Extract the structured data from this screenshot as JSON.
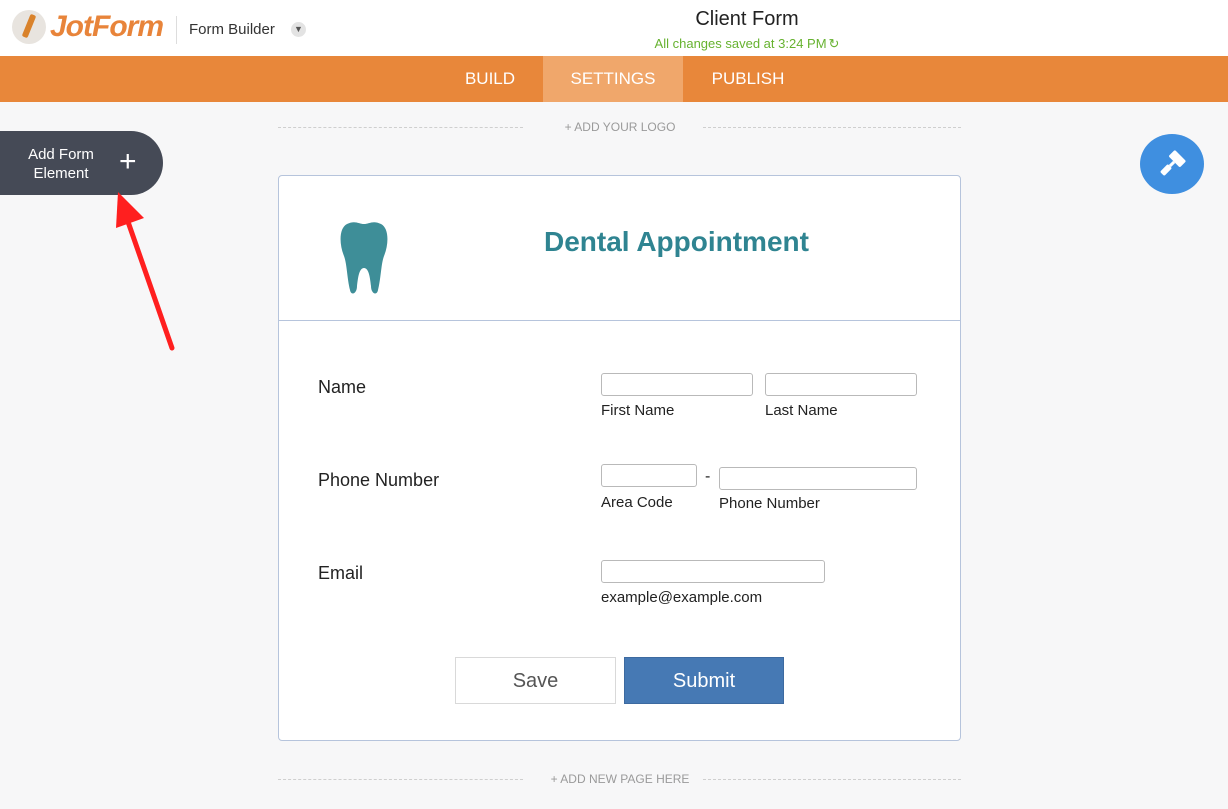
{
  "header": {
    "logo_text": "JotForm",
    "builder_label": "Form Builder",
    "form_title": "Client Form",
    "save_status": "All changes saved at 3:24 PM"
  },
  "nav": {
    "tabs": [
      {
        "label": "BUILD",
        "active": false
      },
      {
        "label": "SETTINGS",
        "active": true
      },
      {
        "label": "PUBLISH",
        "active": false
      }
    ]
  },
  "sidebar": {
    "add_element_label": "Add Form Element"
  },
  "canvas": {
    "add_logo_label": "+ ADD YOUR LOGO",
    "add_page_label": "+ ADD NEW PAGE HERE"
  },
  "form": {
    "heading": "Dental Appointment",
    "fields": {
      "name": {
        "label": "Name",
        "first_sublabel": "First Name",
        "last_sublabel": "Last Name"
      },
      "phone": {
        "label": "Phone Number",
        "area_sublabel": "Area Code",
        "separator": "-",
        "number_sublabel": "Phone Number"
      },
      "email": {
        "label": "Email",
        "sublabel": "example@example.com"
      }
    },
    "buttons": {
      "save": "Save",
      "submit": "Submit"
    }
  },
  "colors": {
    "brand_orange": "#e8873a",
    "active_tab": "#f0a76b",
    "heading_teal": "#2f8491",
    "submit_blue": "#4679b4",
    "status_green": "#66b22f",
    "annotation_red": "#ff1f1f"
  },
  "icons": [
    "jotform-logo-icon",
    "chevron-down-icon",
    "refresh-icon",
    "plus-icon",
    "paint-roller-icon",
    "tooth-icon",
    "annotation-arrow-icon"
  ]
}
